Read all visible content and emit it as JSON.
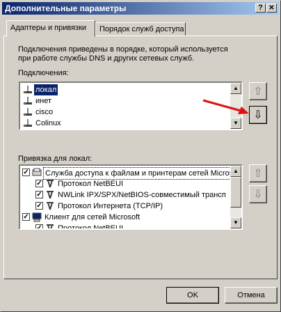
{
  "window": {
    "title": "Дополнительные параметры",
    "help_btn": "?",
    "close_btn": "✕"
  },
  "tabs": [
    {
      "label": "Адаптеры и привязки",
      "active": true
    },
    {
      "label": "Порядок служб доступа",
      "active": false
    }
  ],
  "description_line1": "Подключения приведены в порядке, который используется",
  "description_line2": "при работе службы DNS и других сетевых служб.",
  "connections": {
    "label": "Подключения:",
    "items": [
      {
        "label": "локал",
        "selected": true
      },
      {
        "label": "инет",
        "selected": false
      },
      {
        "label": "cisco",
        "selected": false
      },
      {
        "label": "Colinux",
        "selected": false
      }
    ],
    "up_icon": "arrow-up",
    "down_icon": "arrow-down"
  },
  "bindings": {
    "label": "Привязка для локал:",
    "items": [
      {
        "label": "Служба доступа к файлам и принтерам сетей Microsoft",
        "checked": true,
        "indent": 0,
        "focused": true
      },
      {
        "label": "Протокол NetBEUI",
        "checked": true,
        "indent": 1
      },
      {
        "label": "NWLink IPX/SPX/NetBIOS-совместимый трансп",
        "checked": true,
        "indent": 1
      },
      {
        "label": "Протокол Интернета (TCP/IP)",
        "checked": true,
        "indent": 1
      },
      {
        "label": "Клиент для сетей Microsoft",
        "checked": true,
        "indent": 0
      },
      {
        "label": "Протокол NetBEUI",
        "checked": true,
        "indent": 1
      }
    ]
  },
  "buttons": {
    "ok": "OK",
    "cancel": "Отмена"
  },
  "annotation_color": "#e01010",
  "selection_color": "#0a246a"
}
